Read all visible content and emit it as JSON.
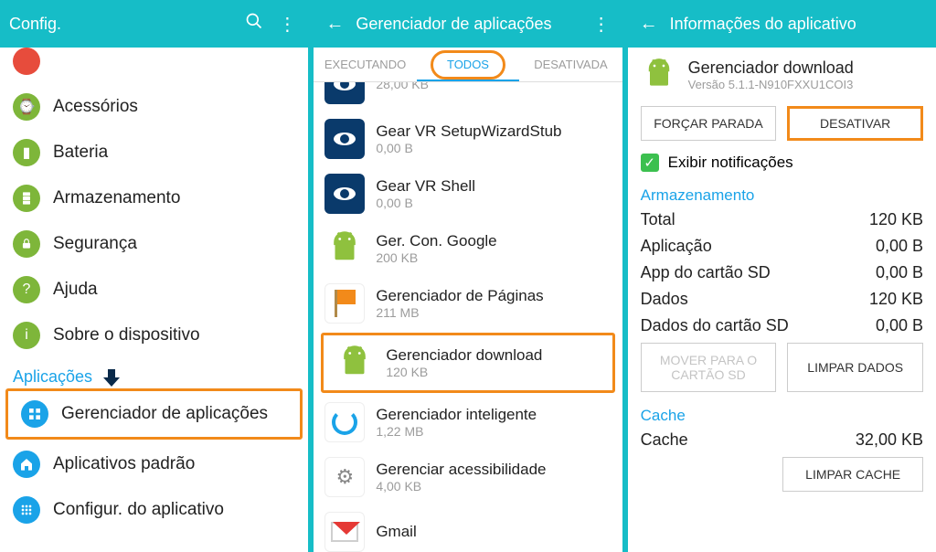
{
  "panel1": {
    "header": {
      "title": "Config."
    },
    "items": [
      {
        "label": "Acessórios",
        "icon": "watch-icon",
        "color": "c-green"
      },
      {
        "label": "Bateria",
        "icon": "battery-icon",
        "color": "c-green"
      },
      {
        "label": "Armazenamento",
        "icon": "storage-icon",
        "color": "c-green"
      },
      {
        "label": "Segurança",
        "icon": "lock-icon",
        "color": "c-green"
      },
      {
        "label": "Ajuda",
        "icon": "help-icon",
        "color": "c-green"
      },
      {
        "label": "Sobre o dispositivo",
        "icon": "info-icon",
        "color": "c-green"
      }
    ],
    "section_label": "Aplicações",
    "section_items": [
      {
        "label": "Gerenciador de aplicações",
        "icon": "grid-icon",
        "color": "c-blue",
        "highlight": true
      },
      {
        "label": "Aplicativos padrão",
        "icon": "home-icon",
        "color": "c-blue"
      },
      {
        "label": "Configur. do aplicativo",
        "icon": "apps-icon",
        "color": "c-blue"
      }
    ]
  },
  "panel2": {
    "header": {
      "title": "Gerenciador de aplicações"
    },
    "tabs": [
      {
        "label": "EXECUTANDO",
        "active": false
      },
      {
        "label": "TODOS",
        "active": true,
        "circled": true
      },
      {
        "label": "DESATIVADA",
        "active": false
      }
    ],
    "apps": [
      {
        "name": "",
        "size": "28,00 KB",
        "icon": "gear-blue",
        "partial": true
      },
      {
        "name": "Gear VR SetupWizardStub",
        "size": "0,00 B",
        "icon": "gear-blue"
      },
      {
        "name": "Gear VR Shell",
        "size": "0,00 B",
        "icon": "gear-blue"
      },
      {
        "name": "Ger. Con. Google",
        "size": "200 KB",
        "icon": "android"
      },
      {
        "name": "Gerenciador de Páginas",
        "size": "211 MB",
        "icon": "flag"
      },
      {
        "name": "Gerenciador download",
        "size": "120 KB",
        "icon": "android",
        "highlight": true
      },
      {
        "name": "Gerenciador inteligente",
        "size": "1,22 MB",
        "icon": "spin"
      },
      {
        "name": "Gerenciar acessibilidade",
        "size": "4,00 KB",
        "icon": "cog"
      },
      {
        "name": "Gmail",
        "size": "",
        "icon": "gmail",
        "partial": true
      }
    ]
  },
  "panel3": {
    "header": {
      "title": "Informações do aplicativo"
    },
    "app": {
      "name": "Gerenciador download",
      "version": "Versão 5.1.1-N910FXXU1COI3"
    },
    "buttons": {
      "force_stop": "FORÇAR PARADA",
      "disable": "DESATIVAR"
    },
    "notify_label": "Exibir notificações",
    "storage_label": "Armazenamento",
    "storage": [
      {
        "k": "Total",
        "v": "120 KB"
      },
      {
        "k": "Aplicação",
        "v": "0,00 B"
      },
      {
        "k": "App do cartão SD",
        "v": "0,00 B"
      },
      {
        "k": "Dados",
        "v": "120 KB"
      },
      {
        "k": "Dados do cartão SD",
        "v": "0,00 B"
      }
    ],
    "storage_buttons": {
      "move_sd": "MOVER PARA O CARTÃO SD",
      "clear_data": "LIMPAR DADOS"
    },
    "cache_label": "Cache",
    "cache": {
      "k": "Cache",
      "v": "32,00 KB"
    },
    "cache_button": "LIMPAR CACHE"
  }
}
